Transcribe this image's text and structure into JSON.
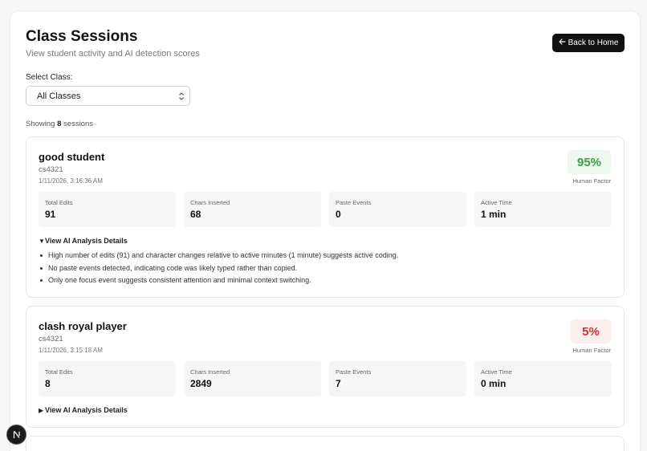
{
  "header": {
    "title": "Class Sessions",
    "subtitle": "View student activity and AI detection scores",
    "back_button": "Back to Home",
    "back_icon": "arrow-left-icon"
  },
  "filter": {
    "label": "Select Class:",
    "selected": "All Classes"
  },
  "summary": {
    "prefix": "Showing",
    "count": "8",
    "suffix": "sessions"
  },
  "sessions": [
    {
      "name": "good student",
      "class": "cs4321",
      "datetime": "1/11/2026, 3:16:36 AM",
      "score": "95%",
      "score_label": "Human Factor",
      "score_status": "good",
      "score_color": "#3e9b4f",
      "stats": [
        {
          "label": "Total Edits",
          "value": "91"
        },
        {
          "label": "Chars Inserted",
          "value": "68"
        },
        {
          "label": "Paste Events",
          "value": "0"
        },
        {
          "label": "Active Time",
          "value": "1 min"
        }
      ],
      "details_label": "View AI Analysis Details",
      "details_expanded": true,
      "details": [
        "High number of edits (91) and character changes relative to active minutes (1 minute) suggests active coding.",
        "No paste events detected, indicating code was likely typed rather than copied.",
        "Only one focus event suggests consistent attention and minimal context switching."
      ]
    },
    {
      "name": "clash royal player",
      "class": "cs4321",
      "datetime": "1/11/2026, 3:15:18 AM",
      "score": "5%",
      "score_label": "Human Factor",
      "score_status": "bad",
      "score_color": "#c8333b",
      "stats": [
        {
          "label": "Total Edits",
          "value": "8"
        },
        {
          "label": "Chars Inserted",
          "value": "2849"
        },
        {
          "label": "Paste Events",
          "value": "7"
        },
        {
          "label": "Active Time",
          "value": "0 min"
        }
      ],
      "details_label": "View AI Analysis Details",
      "details_expanded": false
    }
  ],
  "fab": {
    "letter": "N",
    "icon": "nextjs-logo-icon"
  }
}
